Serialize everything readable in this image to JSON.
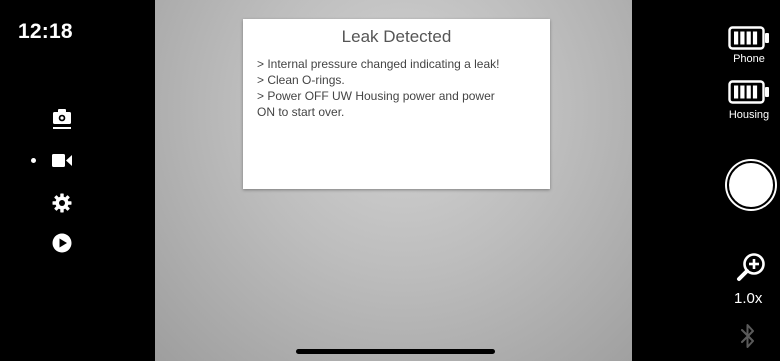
{
  "status": {
    "time": "12:18"
  },
  "left_menu": {
    "items": [
      {
        "name": "camera-icon"
      },
      {
        "name": "video-icon",
        "selected": true
      },
      {
        "name": "gear-icon"
      },
      {
        "name": "play-icon"
      }
    ]
  },
  "alert": {
    "title": "Leak Detected",
    "lines": [
      "> Internal pressure changed indicating a leak!",
      "> Clean O-rings.",
      "> Power OFF UW Housing power and power",
      "ON to start over."
    ]
  },
  "right_panel": {
    "phone_battery_label": "Phone",
    "housing_battery_label": "Housing",
    "zoom_level": "1.0x",
    "icons": [
      "battery-icon",
      "shutter-button",
      "zoom-in-icon",
      "bluetooth-icon"
    ]
  },
  "colors": {
    "bar_background": "#000000",
    "alert_background": "#ffffff",
    "viewfinder_gray": "#bdbdbd"
  }
}
